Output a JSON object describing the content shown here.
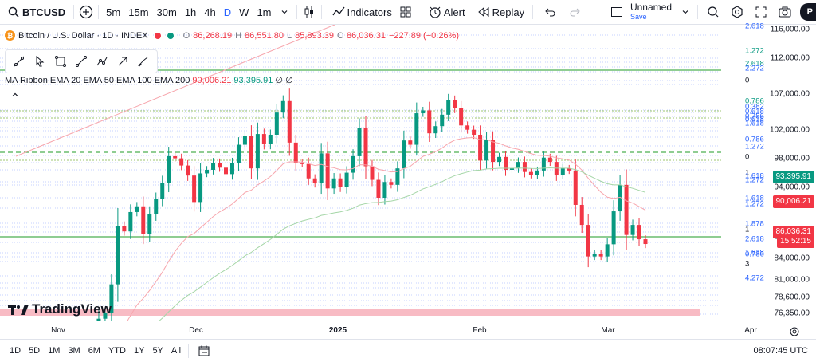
{
  "toolbar": {
    "symbol": "BTCUSD",
    "timeframes": [
      "5m",
      "15m",
      "30m",
      "1h",
      "4h",
      "D",
      "W",
      "1m"
    ],
    "active_timeframe": "D",
    "indicators_label": "Indicators",
    "alert_label": "Alert",
    "replay_label": "Replay",
    "layout_name": "Unnamed",
    "layout_save": "Save",
    "avatar_letter": "P"
  },
  "legend": {
    "title": "Bitcoin / U.S. Dollar · 1D · INDEX",
    "open_label": "O",
    "open": "86,268.19",
    "high_label": "H",
    "high": "86,551.80",
    "low_label": "L",
    "low": "85,893.39",
    "close_label": "C",
    "close": "86,036.31",
    "change": "−227.89 (−0.26%)"
  },
  "ma_ribbon": {
    "label": "MA Ribbon EMA 20 EMA 50 EMA 100 EMA 200",
    "v1": "90,006.21",
    "v2": "93,395.91",
    "v3": "∅",
    "v4": "∅"
  },
  "drawing_tools": [
    "trend-line-icon",
    "cursor-icon",
    "rectangle-icon",
    "line-icon",
    "path-icon",
    "arrow-icon",
    "brush-icon"
  ],
  "price_axis": {
    "labels": [
      "116,000.00",
      "112,000.00",
      "107,000.00",
      "102,000.00",
      "98,000.00",
      "94,000.00",
      "87,000.00",
      "84,000.00",
      "81,000.00",
      "78,600.00",
      "76,350.00"
    ],
    "ema20_tag": "90,006.21",
    "ema50_tag": "93,395.91",
    "last_price_tag": "86,036.31",
    "countdown_tag": "15:52:15"
  },
  "fib_labels": [
    {
      "text": "2.618",
      "color": "#2962ff"
    },
    {
      "text": "1.272",
      "color": "#089981"
    },
    {
      "text": "2.618",
      "color": "#089981"
    },
    {
      "text": "2.272",
      "color": "#2962ff"
    },
    {
      "text": "0",
      "color": "#131722"
    },
    {
      "text": "0.786",
      "color": "#089981"
    },
    {
      "text": "0.382",
      "color": "#2962ff"
    },
    {
      "text": "0.618",
      "color": "#2962ff"
    },
    {
      "text": "0.786",
      "color": "#2962ff"
    },
    {
      "text": "0.618",
      "color": "#2962ff"
    },
    {
      "text": "1.618",
      "color": "#2962ff"
    },
    {
      "text": "0.786",
      "color": "#2962ff"
    },
    {
      "text": "1.272",
      "color": "#2962ff"
    },
    {
      "text": "0",
      "color": "#131722"
    },
    {
      "text": "1",
      "color": "#131722"
    },
    {
      "text": "1.618",
      "color": "#2962ff"
    },
    {
      "text": "1.272",
      "color": "#2962ff"
    },
    {
      "text": "1.618",
      "color": "#2962ff"
    },
    {
      "text": "1.272",
      "color": "#2962ff"
    },
    {
      "text": "1.878",
      "color": "#2962ff"
    },
    {
      "text": "1",
      "color": "#131722"
    },
    {
      "text": "2.618",
      "color": "#2962ff"
    },
    {
      "text": "1.618",
      "color": "#2962ff"
    },
    {
      "text": "0.786",
      "color": "#2962ff"
    },
    {
      "text": "3",
      "color": "#131722"
    },
    {
      "text": "4.272",
      "color": "#2962ff"
    }
  ],
  "time_axis": [
    "Nov",
    "Dec",
    "2025",
    "Feb",
    "Mar",
    "Apr"
  ],
  "bottom": {
    "ranges": [
      "1D",
      "5D",
      "1M",
      "3M",
      "6M",
      "YTD",
      "1Y",
      "5Y",
      "All"
    ],
    "clock": "08:07:45 UTC"
  },
  "brand": "TradingView",
  "colors": {
    "up": "#089981",
    "down": "#f23645",
    "accent": "#2962ff",
    "ema20": "#f7a6ad",
    "ema50": "#a5d6a7"
  },
  "chart_data": {
    "type": "candlestick",
    "symbol": "BTCUSD",
    "candles_close": [
      69500,
      72300,
      75600,
      76400,
      80400,
      88600,
      87800,
      90500,
      91300,
      87400,
      90200,
      92300,
      94600,
      98300,
      98000,
      97000,
      95600,
      91900,
      95900,
      96400,
      97400,
      96700,
      95800,
      97300,
      99900,
      101100,
      96600,
      101400,
      100000,
      101300,
      104400,
      106000,
      100200,
      97400,
      97200,
      95200,
      94500,
      98700,
      93800,
      95200,
      94000,
      96000,
      98300,
      102200,
      96900,
      95000,
      92500,
      94700,
      94300,
      96600,
      100500,
      99900,
      104300,
      104700,
      101500,
      102500,
      104100,
      106100,
      105000,
      102600,
      102000,
      101300,
      97700,
      100600,
      97500,
      98200,
      96400,
      96600,
      97500,
      96100,
      95700,
      96300,
      98100,
      97500,
      95700,
      96600,
      96300,
      91500,
      88700,
      84300,
      84700,
      84300,
      86000,
      90600,
      94300,
      87300,
      88700,
      86700,
      86036
    ],
    "price_range": [
      76350,
      116000
    ]
  }
}
